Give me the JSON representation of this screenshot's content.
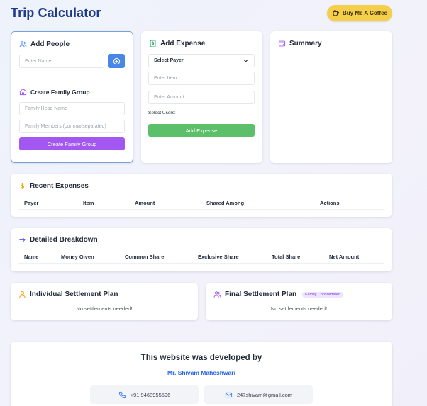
{
  "app": {
    "title": "Trip Calculator",
    "coffee_button": "Buy Me A Coffee"
  },
  "add_people": {
    "title": "Add People",
    "name_placeholder": "Enter Name",
    "family_title": "Create Family Group",
    "family_head_placeholder": "Family Head Name",
    "family_members_placeholder": "Family Members (comma-separated)",
    "create_button": "Create Family Group"
  },
  "add_expense": {
    "title": "Add Expense",
    "payer_select": "Select Payer",
    "item_placeholder": "Enter Item",
    "amount_placeholder": "Enter Amount",
    "select_users_label": "Select Users:",
    "add_button": "Add Expense"
  },
  "summary": {
    "title": "Summary"
  },
  "recent_expenses": {
    "title": "Recent Expenses",
    "columns": [
      "Payer",
      "Item",
      "Amount",
      "Shared Among",
      "Actions"
    ]
  },
  "detailed_breakdown": {
    "title": "Detailed Breakdown",
    "columns": [
      "Name",
      "Money Given",
      "Common Share",
      "Exclusive Share",
      "Total Share",
      "Net Amount"
    ]
  },
  "individual_settlement": {
    "title": "Individual Settlement Plan",
    "empty": "No settlements needed!"
  },
  "final_settlement": {
    "title": "Final Settlement Plan",
    "badge": "Family Consolidated",
    "empty": "No settlements needed!"
  },
  "footer": {
    "heading": "This website was developed by",
    "developer": "Mr. Shivam Maheshwari",
    "phone": "+91 9468955596",
    "email": "247shivam@gmail.com"
  },
  "colors": {
    "title": "#1e3a8a",
    "coffee": "#f5cf4a",
    "blue_button": "#4a86e8",
    "purple_button": "#a257f0",
    "green_button": "#5cc06a",
    "purple_accent": "#7c3aed"
  }
}
